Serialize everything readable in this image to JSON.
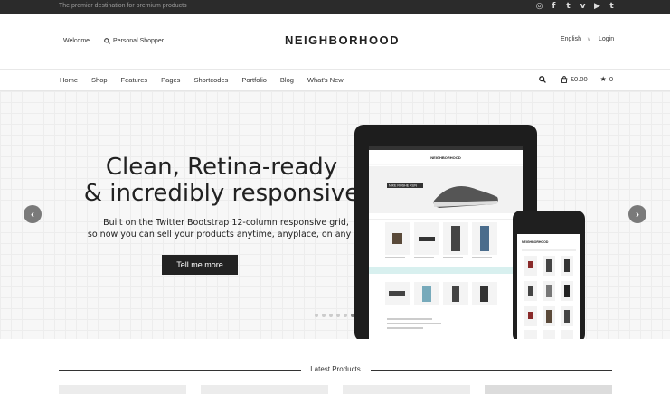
{
  "topbar": {
    "tagline": "The premier destination for premium products",
    "social_icons": [
      "dribbble-icon",
      "facebook-icon",
      "twitter-icon",
      "vimeo-icon",
      "youtube-icon",
      "tumblr-icon"
    ]
  },
  "header": {
    "welcome": "Welcome",
    "personal_shopper": "Personal Shopper",
    "logo": "NEIGHBORHOOD",
    "language": "English",
    "login": "Login"
  },
  "nav": {
    "items": [
      "Home",
      "Shop",
      "Features",
      "Pages",
      "Shortcodes",
      "Portfolio",
      "Blog",
      "What's New"
    ],
    "cart_total": "£0.00",
    "wishlist_count": "0"
  },
  "hero": {
    "headline_line1": "Clean, Retina-ready",
    "headline_line2": "& incredibly responsive",
    "sub_line1": "Built on the Twitter Bootstrap 12-column responsive grid,",
    "sub_line2": "so now you can sell your products anytime, anyplace, on any de",
    "cta": "Tell me more",
    "slide_count": 6,
    "active_slide": 6
  },
  "mockup": {
    "tablet_logo": "NEIGHBORHOOD",
    "tablet_banner": "NIKE ROSHE RUN",
    "phone_logo": "NEIGHBORHOOD"
  },
  "latest": {
    "title": "Latest Products"
  },
  "colors": {
    "topbar": "#2b2b2b",
    "cta": "#222222",
    "accent_teal": "#d8f0ef"
  }
}
